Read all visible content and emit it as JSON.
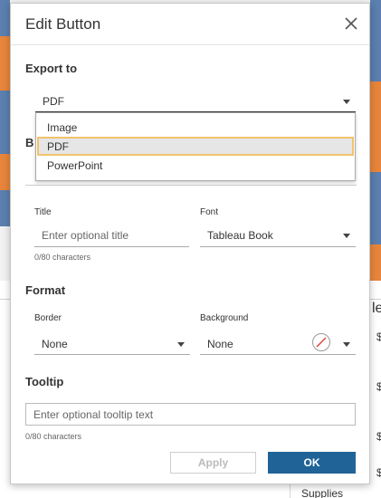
{
  "dialog": {
    "title": "Edit Button",
    "close_icon": "close-icon"
  },
  "export_to": {
    "label": "Export to",
    "selected": "PDF",
    "options": [
      "Image",
      "PDF",
      "PowerPoint"
    ],
    "highlighted": "PDF"
  },
  "partially_hidden_label": "B",
  "title_field": {
    "label": "Title",
    "placeholder": "Enter optional title",
    "counter": "0/80 characters"
  },
  "font_field": {
    "label": "Font",
    "value": "Tableau Book"
  },
  "format": {
    "label": "Format",
    "border_label": "Border",
    "border_value": "None",
    "background_label": "Background",
    "background_value": "None"
  },
  "tooltip": {
    "label": "Tooltip",
    "placeholder": "Enter optional tooltip text",
    "counter": "0/80 characters"
  },
  "buttons": {
    "apply": "Apply",
    "ok": "OK"
  },
  "background_sheet": {
    "right_header_fragment": "le",
    "dollar_fragments": [
      "$",
      "$",
      "$",
      "$"
    ],
    "bottom_fragment": "Supplies"
  },
  "colors": {
    "ok_button": "#1f6397",
    "highlight_border": "#f0c36d",
    "map_blue": "#5b7fae",
    "map_orange": "#e8853b"
  }
}
